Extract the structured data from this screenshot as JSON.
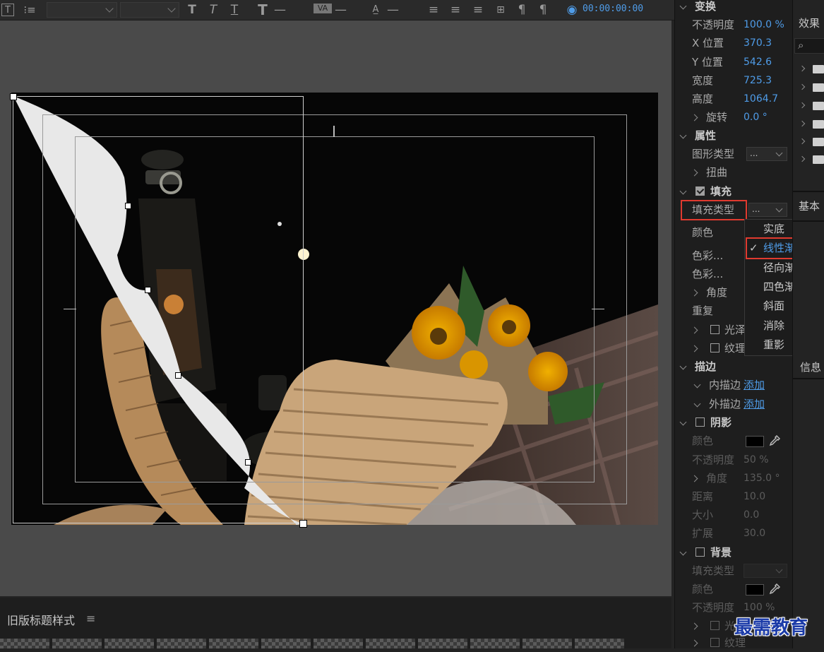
{
  "toolbar": {
    "timecode": "00:00:00:00",
    "bold_glyph": "T",
    "italic_glyph": "T",
    "underline_glyph": "T",
    "size_glyph": "T",
    "kerning_glyph": "VA",
    "dash": "—"
  },
  "panel": {
    "transform": {
      "title": "变换",
      "opacity_label": "不透明度",
      "opacity_value": "100.0 %",
      "x_label": "X 位置",
      "x_value": "370.3",
      "y_label": "Y 位置",
      "y_value": "542.6",
      "width_label": "宽度",
      "width_value": "725.3",
      "height_label": "高度",
      "height_value": "1064.7",
      "rotate_label": "旋转",
      "rotate_value": "0.0 °"
    },
    "attributes": {
      "title": "属性",
      "shape_type_label": "图形类型",
      "shape_type_value": "...",
      "distort_label": "扭曲"
    },
    "fill": {
      "title": "填充",
      "fill_type_label": "填充类型",
      "fill_type_value": "...",
      "color_label": "颜色",
      "color1_label": "色彩...",
      "color2_label": "色彩...",
      "angle_label": "角度",
      "repeat_label": "重复",
      "gloss_label": "光泽",
      "texture_label": "纹理"
    },
    "stroke": {
      "title": "描边",
      "inner_label": "内描边",
      "inner_add": "添加",
      "outer_label": "外描边",
      "outer_add": "添加"
    },
    "shadow": {
      "title": "阴影",
      "color_label": "颜色",
      "opacity_label": "不透明度",
      "opacity_value": "50 %",
      "angle_label": "角度",
      "angle_value": "135.0 °",
      "distance_label": "距离",
      "distance_value": "10.0",
      "size_label": "大小",
      "size_value": "0.0",
      "spread_label": "扩展",
      "spread_value": "30.0"
    },
    "background": {
      "title": "背景",
      "fill_type_label": "填充类型",
      "color_label": "颜色",
      "opacity_label": "不透明度",
      "opacity_value": "100 %",
      "gloss_label": "光泽",
      "texture_label": "纹理"
    }
  },
  "fill_menu": {
    "items": [
      "实底",
      "线性渐变",
      "径向渐变",
      "四色渐变",
      "斜面",
      "消除",
      "重影"
    ],
    "checkmark": "✓"
  },
  "side": {
    "effects_label": "效果",
    "basic_label": "基本",
    "info_label": "信息",
    "search_glyph": "⌕"
  },
  "bottom": {
    "title": "旧版标题样式",
    "menu_glyph": "≡"
  },
  "watermark": "最需教育",
  "colors": {
    "accent": "#4f9ce8",
    "highlight_box": "#e03a2f"
  }
}
